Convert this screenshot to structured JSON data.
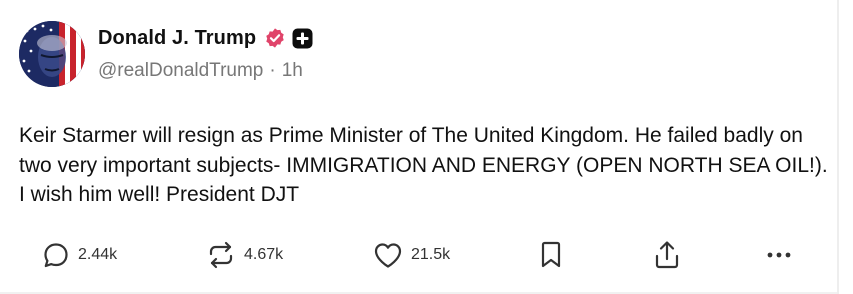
{
  "post": {
    "author": {
      "display_name": "Donald J. Trump",
      "handle": "@realDonaldTrump",
      "avatar_icon": "flag-portrait-avatar",
      "verified_icon": "verified-badge-icon",
      "badge_icon": "plus-badge-icon",
      "verified_color": "#e0446a"
    },
    "separator": "·",
    "time_ago": "1h",
    "text": "Keir Starmer will resign as Prime Minister of The United Kingdom. He failed badly on two very important subjects- IMMIGRATION AND ENERGY (OPEN NORTH SEA OIL!). I wish him well! President DJT"
  },
  "actions": {
    "reply": {
      "icon": "reply-icon",
      "count": "2.44k"
    },
    "repost": {
      "icon": "repost-icon",
      "count": "4.67k"
    },
    "like": {
      "icon": "heart-icon",
      "count": "21.5k"
    },
    "bookmark": {
      "icon": "bookmark-icon"
    },
    "share": {
      "icon": "share-icon"
    },
    "more": {
      "icon": "more-icon"
    }
  }
}
